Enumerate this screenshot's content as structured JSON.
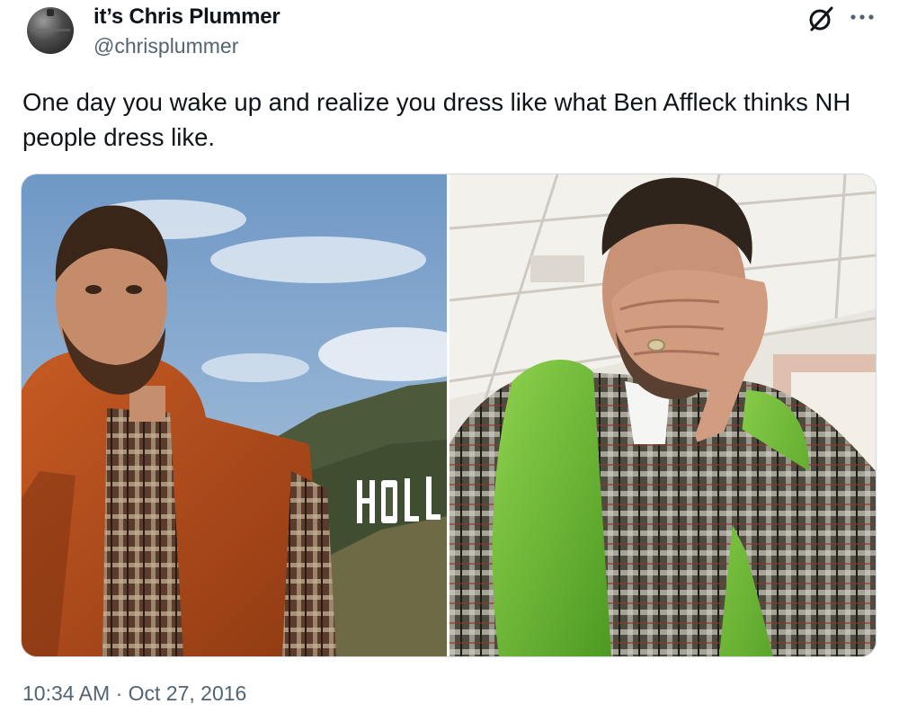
{
  "author": {
    "display_name": "it’s Chris Plummer",
    "handle": "@chrisplummer"
  },
  "tweet": {
    "text": "One day you wake up and realize you dress like what Ben Affleck thinks NH people dress like."
  },
  "media": {
    "left_sign_text": "HOLL",
    "count": 2
  },
  "meta": {
    "time": "10:34 AM",
    "separator": " · ",
    "date": "Oct 27, 2016"
  },
  "icons": {
    "grok": "grok-icon",
    "more": "more-icon"
  },
  "colors": {
    "text": "#0f1419",
    "secondary": "#536471",
    "border": "#cfd9de"
  }
}
